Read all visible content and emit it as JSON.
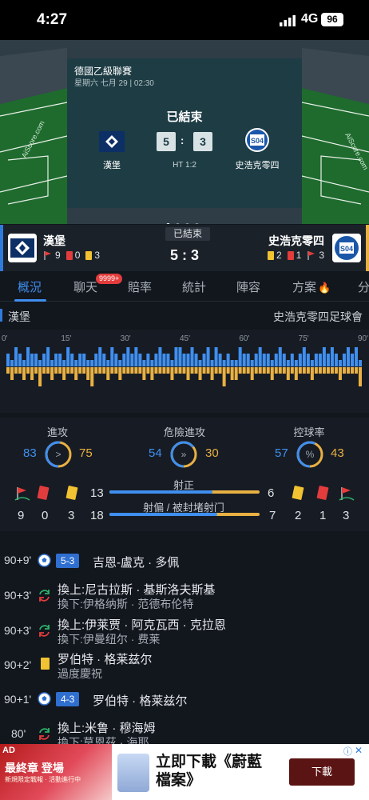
{
  "status_bar": {
    "time": "4:27",
    "network": "4G",
    "battery": "96"
  },
  "match": {
    "league": "德國乙級聯賽",
    "datetime": "星期六 七月 29 | 02:30",
    "status": "已結束",
    "home": {
      "name": "漢堡",
      "score": "5",
      "corners": "9",
      "red_cards": "0",
      "yellow_cards": "3",
      "full_name": "漢堡"
    },
    "away": {
      "name": "史浩克零四",
      "score": "3",
      "corners": "3",
      "red_cards": "1",
      "yellow_cards": "2",
      "full_name": "史浩克零四足球會"
    },
    "halftime": "HT 1:2",
    "score_text": "5 : 3",
    "score_sep": ":"
  },
  "tabs": [
    {
      "label": "概況",
      "active": true
    },
    {
      "label": "聊天",
      "badge": "9999+"
    },
    {
      "label": "賠率"
    },
    {
      "label": "統計"
    },
    {
      "label": "陣容"
    },
    {
      "label": "方案"
    },
    {
      "label": "分"
    }
  ],
  "timeline": {
    "minute_marks": [
      "0'",
      "15'",
      "30'",
      "45'",
      "60'",
      "75'",
      "90'"
    ],
    "home_pressure": [
      2,
      1,
      3,
      2,
      1,
      3,
      2,
      2,
      1,
      2,
      3,
      1,
      2,
      2,
      1,
      3,
      2,
      1,
      2,
      2,
      1,
      1,
      2,
      3,
      2,
      1,
      3,
      2,
      1,
      2,
      3,
      2,
      3,
      2,
      1,
      2,
      1,
      2,
      3,
      2,
      2,
      1,
      3,
      3,
      2,
      2,
      3,
      2,
      1,
      2,
      3,
      1,
      3,
      2,
      1,
      2,
      1,
      1,
      3,
      2,
      2,
      1,
      2,
      3,
      2,
      2,
      1,
      2,
      3,
      2,
      1,
      2,
      1,
      2,
      3,
      2,
      1,
      2,
      2,
      3,
      2,
      3,
      2,
      1,
      2,
      3,
      2,
      3,
      1
    ],
    "away_pressure": [
      1,
      2,
      1,
      1,
      2,
      1,
      2,
      1,
      3,
      1,
      1,
      2,
      1,
      1,
      2,
      1,
      1,
      2,
      1,
      1,
      2,
      3,
      1,
      1,
      1,
      2,
      1,
      1,
      2,
      1,
      1,
      1,
      1,
      1,
      2,
      1,
      2,
      1,
      1,
      1,
      1,
      2,
      1,
      1,
      1,
      2,
      1,
      1,
      2,
      1,
      1,
      2,
      1,
      1,
      3,
      1,
      2,
      2,
      1,
      1,
      1,
      2,
      1,
      1,
      1,
      1,
      2,
      1,
      1,
      1,
      2,
      1,
      2,
      1,
      1,
      1,
      2,
      1,
      1,
      1,
      1,
      1,
      1,
      2,
      1,
      1,
      1,
      1,
      3
    ]
  },
  "stats": {
    "attack": {
      "label": "進攻",
      "home": "83",
      "away": "75",
      "home_share": 0.525
    },
    "danger": {
      "label": "危險進攻",
      "home": "54",
      "away": "30",
      "home_share": 0.643
    },
    "possession": {
      "label": "控球率",
      "home": "57",
      "away": "43",
      "home_share": 0.57
    },
    "shots_on": {
      "label": "射正",
      "home": "13",
      "away": "6",
      "home_share": 0.684
    },
    "shots_off": {
      "label": "射偏 / 被封堵射门",
      "home": "18",
      "away": "7",
      "home_share": 0.72
    },
    "ring_symbols": {
      "attack": ">",
      "danger": "»",
      "possession": "%"
    },
    "colors": {
      "home": "#3f8ff0",
      "away": "#e9b043"
    }
  },
  "events": [
    {
      "minute": "90+9'",
      "type": "goal",
      "score": "5-3",
      "main": "吉恩-盧克 · 多佩",
      "sub": ""
    },
    {
      "minute": "90+3'",
      "type": "sub",
      "main": "換上:尼古拉斯 · 基斯洛夫斯基",
      "sub": "換下:伊格纳斯 · 范德布伦特"
    },
    {
      "minute": "90+3'",
      "type": "sub",
      "main": "換上:伊莱贾 · 阿克瓦西 · 克拉恩",
      "sub": "換下:伊曼纽尔 · 费莱"
    },
    {
      "minute": "90+2'",
      "type": "yellow",
      "main": "罗伯特 · 格莱兹尔",
      "sub": "過度慶祝"
    },
    {
      "minute": "90+1'",
      "type": "goal",
      "score": "4-3",
      "main": "罗伯特 · 格莱兹尔",
      "sub": ""
    },
    {
      "minute": "80'",
      "type": "sub",
      "main": "換上:米鲁 · 穆海姆",
      "sub": "換下:莫恩茲 · 海耶"
    }
  ],
  "ad": {
    "tag": "AD",
    "game_title": "最終章 登場",
    "game_small": "新規限定戰報 · 活動進行中",
    "headline": "立即下載《蔚藍檔案》",
    "button": "下載",
    "close": "✕",
    "info": "ⓘ"
  }
}
